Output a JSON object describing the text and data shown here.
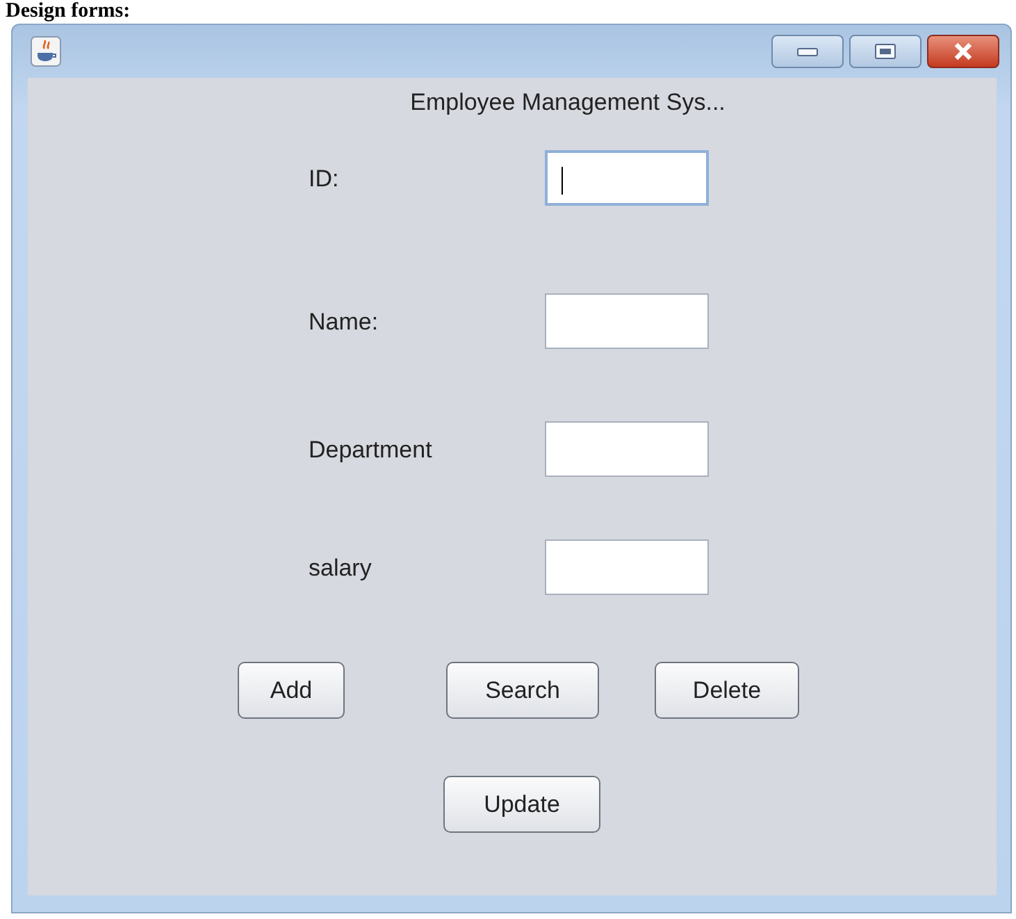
{
  "heading": "Design forms:",
  "window": {
    "title": "Employee Management Sys..."
  },
  "fields": [
    {
      "label": "ID:",
      "focused": true
    },
    {
      "label": "Name:",
      "focused": false
    },
    {
      "label": "Department",
      "focused": false
    },
    {
      "label": "salary",
      "focused": false
    }
  ],
  "buttons": [
    {
      "label": "Add"
    },
    {
      "label": "Search"
    },
    {
      "label": "Delete"
    }
  ],
  "update_button": {
    "label": "Update"
  }
}
